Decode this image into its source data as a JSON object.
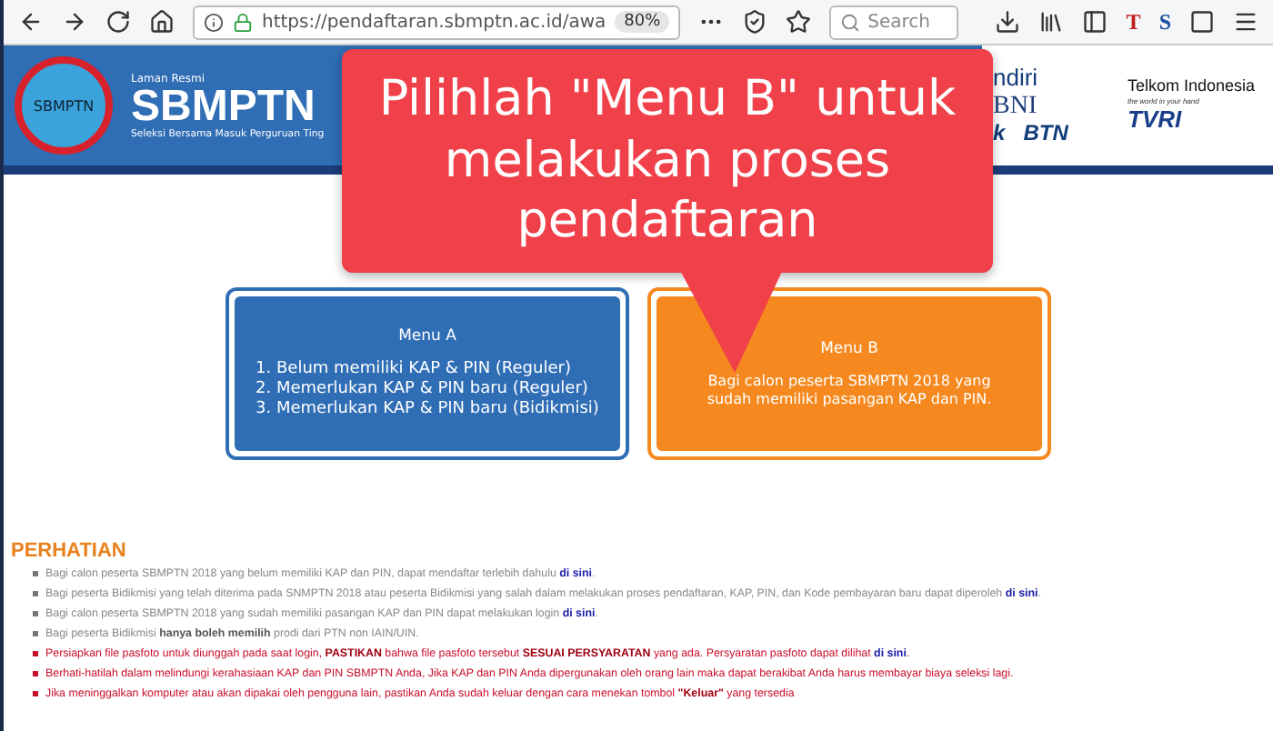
{
  "browser": {
    "url": "https://pendaftaran.sbmptn.ac.id/awa",
    "zoom": "80%",
    "search_placeholder": "Search",
    "ext_icons": [
      "T",
      "S"
    ]
  },
  "header": {
    "logo_text": "SBMPTN",
    "overline": "Laman Resmi",
    "title": "SBMPTN",
    "subtitle": "Seleksi Bersama Masuk Perguruan Ting",
    "sponsors": {
      "mandiri": "ndiri",
      "bni": "BNI",
      "k": "k",
      "btn": "BTN",
      "telkom": "Telkom Indonesia",
      "telkom_tag": "the world in your hand",
      "tvri": "TVRI"
    }
  },
  "callout": "Pilihlah \"Menu B\" untuk melakukan proses pendaftaran",
  "menus": [
    {
      "title": "Menu A",
      "color": "#2f6db5",
      "kind": "list",
      "lines": [
        "1. Belum memiliki KAP & PIN (Reguler)",
        "2. Memerlukan KAP & PIN baru (Reguler)",
        "3. Memerlukan KAP & PIN baru (Bidikmisi)"
      ]
    },
    {
      "title": "Menu B",
      "color": "#f5891f",
      "kind": "text",
      "lines": [
        "Bagi calon peserta SBMPTN 2018 yang sudah memiliki pasangan KAP dan PIN."
      ]
    }
  ],
  "notice": {
    "heading": "PERHATIAN",
    "items": [
      {
        "kind": "info",
        "segments": [
          {
            "kind": "text",
            "text": "Bagi calon peserta SBMPTN 2018 yang belum memiliki KAP dan PIN, dapat mendaftar terlebih dahulu "
          },
          {
            "kind": "link",
            "text": "di sini"
          },
          {
            "kind": "text",
            "text": "."
          }
        ]
      },
      {
        "kind": "info",
        "segments": [
          {
            "kind": "text",
            "text": "Bagi peserta Bidikmisi yang telah diterima pada SNMPTN 2018 atau peserta Bidikmisi yang salah dalam melakukan proses pendaftaran, KAP, PIN, dan Kode pembayaran baru dapat diperoleh "
          },
          {
            "kind": "link",
            "text": "di sini"
          },
          {
            "kind": "text",
            "text": "."
          }
        ]
      },
      {
        "kind": "info",
        "segments": [
          {
            "kind": "text",
            "text": "Bagi calon peserta SBMPTN 2018 yang sudah memiliki pasangan KAP dan PIN dapat melakukan login "
          },
          {
            "kind": "link",
            "text": "di sini"
          },
          {
            "kind": "text",
            "text": "."
          }
        ]
      },
      {
        "kind": "info",
        "segments": [
          {
            "kind": "text",
            "text": "Bagi peserta Bidikmisi **hanya boleh memilih** prodi dari PTN non IAIN/UIN."
          }
        ]
      },
      {
        "kind": "warning",
        "segments": [
          {
            "kind": "text",
            "text": "Persiapkan file pasfoto untuk diunggah pada saat login, **PASTIKAN** bahwa file pasfoto tersebut **SESUAI PERSYARATAN** yang ada. Persyaratan pasfoto dapat dilihat "
          },
          {
            "kind": "link",
            "text": "di sini"
          },
          {
            "kind": "text",
            "text": "."
          }
        ]
      },
      {
        "kind": "warning",
        "segments": [
          {
            "kind": "text",
            "text": "Berhati-hatilah dalam melindungi kerahasiaan KAP dan PIN SBMPTN Anda, Jika KAP dan PIN Anda dipergunakan oleh orang lain maka dapat berakibat Anda harus membayar biaya seleksi lagi."
          }
        ]
      },
      {
        "kind": "warning",
        "segments": [
          {
            "kind": "text",
            "text": "Jika meninggalkan komputer atau akan dipakai oleh pengguna lain, pastikan Anda sudah keluar dengan cara menekan tombol **\"Keluar\"** yang tersedia"
          }
        ]
      }
    ]
  }
}
